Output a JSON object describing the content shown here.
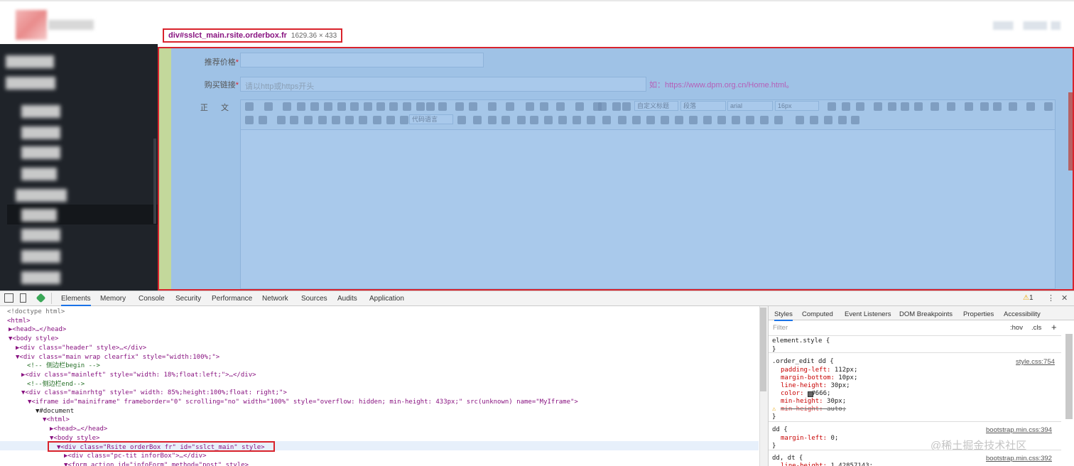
{
  "inspector": {
    "selector": "div#sslct_main.rsite.orderbox.fr",
    "size": "1629.36 × 433"
  },
  "form": {
    "price_label": "推荐价格",
    "required_mark": "*",
    "link_label": "购买链接",
    "link_placeholder": "请以http或https开头",
    "link_hint": "如：https://www.dpm.org.cn/Home.html。",
    "body_label": "正  文"
  },
  "editor_toolbar": {
    "style_select": "自定义标题",
    "para_select": "段落",
    "font_select": "arial",
    "size_select": "16px",
    "code_select": "代码语言"
  },
  "devtools": {
    "tabs": [
      "Elements",
      "Memory",
      "Console",
      "Security",
      "Performance",
      "Network",
      "Sources",
      "Audits",
      "Application"
    ],
    "warning_count": "1",
    "dom_lines": [
      "<!doctype html>",
      "<html>",
      "▶<head>…</head>",
      "▼<body style>",
      "▶<div class=\"header\" style>…</div>",
      "▼<div class=\"main wrap clearfix\" style=\"width:100%;\">",
      "<!-- 侧边栏begin -->",
      "▶<div class=\"mainleft\" style=\"width: 18%;float:left;\">…</div>",
      "<!--侧边栏end-->",
      "▼<div class=\"mainrhtg\" style=\" width: 85%;height:100%;float: right;\">",
      "▼<iframe id=\"mainiframe\" frameborder=\"0\" scrolling=\"no\" width=\"100%\" style=\"overflow: hidden; min-height: 433px;\" src(unknown) name=\"MyIframe\">",
      "▼#document",
      "▼<html>",
      "▶<head>…</head>",
      "▼<body style>",
      "▼<div class=\"Rsite orderBox fr\" id=\"sslct_main\" style>",
      "▶<div class=\"pc-tit inforBox\">…</div>",
      "▼<form action id=\"infoForm\" method=\"post\" style>"
    ],
    "styles_tabs": [
      "Styles",
      "Computed",
      "Event Listeners",
      "DOM Breakpoints",
      "Properties",
      "Accessibility"
    ],
    "filter_placeholder": "Filter",
    "hov": ":hov",
    "cls": ".cls",
    "plus": "+",
    "rules": {
      "element_style": "element.style {",
      "close": "}",
      "r1_selector": ".order_edit dd {",
      "r1_source": "style.css:754",
      "r1_p1": "padding-left: 112px;",
      "r1_p2": "margin-bottom: 10px;",
      "r1_p3": "line-height: 30px;",
      "r1_p4": "color:  #666;",
      "r1_p5": "min-height: 30px;",
      "r1_p6": "min-height: auto;",
      "r2_selector": "dd {",
      "r2_source": "bootstrap.min.css:394",
      "r2_p1": "margin-left: 0;",
      "r3_selector": "dd, dt {",
      "r3_source": "bootstrap.min.css:392",
      "r3_p1": "line-height: 1.42857143;"
    }
  },
  "watermark": "@稀土掘金技术社区",
  "colors": {
    "highlight": "#9fc2e6",
    "outline": "#d9232c",
    "sidebar": "#1f2329"
  }
}
